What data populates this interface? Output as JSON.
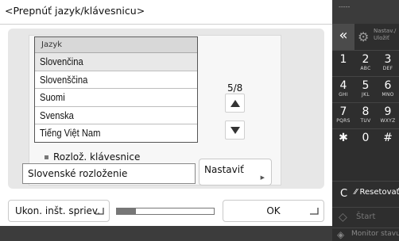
{
  "dialog": {
    "title": "<Prepnúť jazyk/klávesnicu>",
    "list_header": "Jazyk",
    "languages": [
      "Slovenčina",
      "Slovenščina",
      "Suomi",
      "Svenska",
      "Tiếng Việt Nam"
    ],
    "selected_index": 0,
    "page_indicator": "5/8",
    "keyboard_label": "Rozlož. klávesnice",
    "keyboard_value": "Slovenské rozloženie",
    "set_button": "Nastaviť",
    "reset_button": "Ukon. inšt. spriev.",
    "ok_button": "OK",
    "progress": 0.2
  },
  "keypad": {
    "top_text": "-----",
    "back_symbol": "«",
    "settings_label_1": "Nastav./",
    "settings_label_2": "Uložiť",
    "keys": [
      {
        "n": "1",
        "l": ""
      },
      {
        "n": "2",
        "l": "ABC"
      },
      {
        "n": "3",
        "l": "DEF"
      },
      {
        "n": "4",
        "l": "GHI"
      },
      {
        "n": "5",
        "l": "JKL"
      },
      {
        "n": "6",
        "l": "MNO"
      },
      {
        "n": "7",
        "l": "PQRS"
      },
      {
        "n": "8",
        "l": "TUV"
      },
      {
        "n": "9",
        "l": "WXYZ"
      },
      {
        "n": "✱",
        "l": ""
      },
      {
        "n": "0",
        "l": ""
      },
      {
        "n": "#",
        "l": ""
      }
    ],
    "clear": "C",
    "reset": "Resetovať",
    "start": "Štart",
    "monitor": "Monitor stavu"
  }
}
